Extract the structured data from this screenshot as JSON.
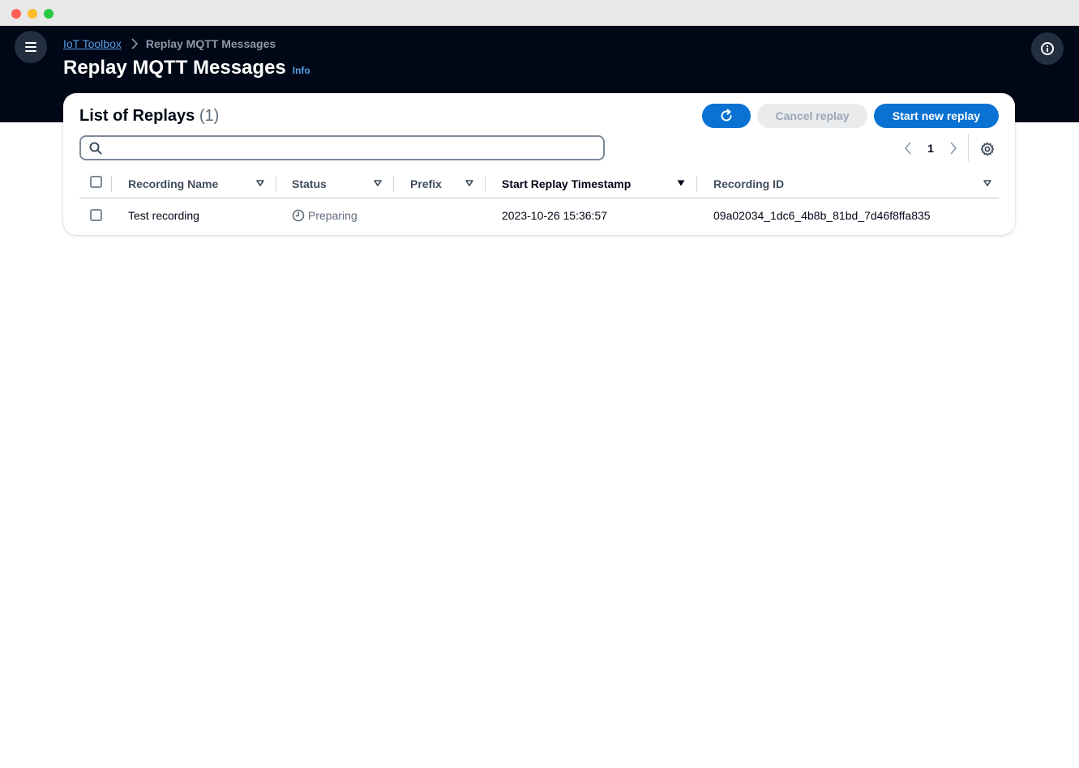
{
  "breadcrumb": {
    "root": "IoT Toolbox",
    "current": "Replay MQTT Messages"
  },
  "page": {
    "title": "Replay MQTT Messages",
    "info": "Info"
  },
  "replays": {
    "title": "List of Replays",
    "count": "(1)",
    "buttons": {
      "cancel": "Cancel replay",
      "start": "Start new replay"
    },
    "search": {
      "placeholder": "",
      "value": ""
    },
    "pagination": {
      "page": "1"
    },
    "columns": [
      "Recording Name",
      "Status",
      "Prefix",
      "Start Replay Timestamp",
      "Recording ID"
    ],
    "sorted_column": "Start Replay Timestamp",
    "rows": [
      {
        "recording_name": "Test recording",
        "status": "Preparing",
        "prefix": "",
        "start_timestamp": "2023-10-26 15:36:57",
        "recording_id": "09a02034_1dc6_4b8b_81bd_7d46f8ffa835"
      }
    ]
  },
  "colors": {
    "header_bg": "#000716",
    "primary_button": "#0972d3",
    "disabled_button": "#e9ebed",
    "link": "#539fe5"
  },
  "icons": {
    "menu": "hamburger-icon",
    "help": "info-icon",
    "refresh": "refresh-icon",
    "search": "search-icon",
    "settings": "gear-icon",
    "status": "clock-icon"
  }
}
